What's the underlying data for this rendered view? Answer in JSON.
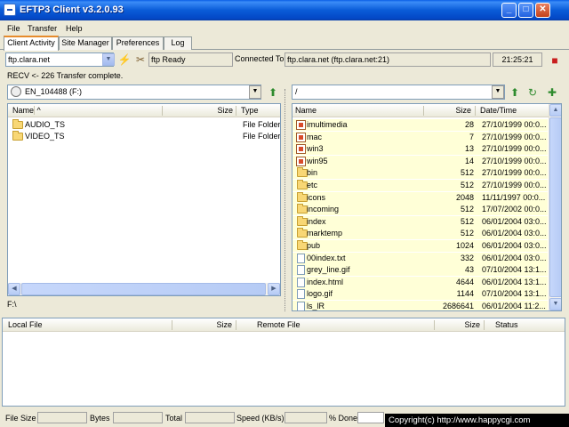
{
  "window": {
    "title": "EFTP3 Client v3.2.0.93"
  },
  "menu": [
    "File",
    "Transfer",
    "Help"
  ],
  "tabs": [
    "Client Activity",
    "Site Manager",
    "Preferences",
    "Log"
  ],
  "connection": {
    "host": "ftp.clara.net",
    "status": "ftp Ready",
    "connected_label": "Connected To",
    "connected_value": "ftp.clara.net (ftp.clara.net:21)",
    "time": "21:25:21"
  },
  "status_message": "RECV <-  226 Transfer complete.",
  "local": {
    "drive": "EN_104488 (F:)",
    "path": "F:\\",
    "columns": [
      "Name",
      "Size",
      "Type"
    ],
    "files": [
      {
        "name": "AUDIO_TS",
        "size": "",
        "type": "File Folder",
        "icon": "folder-icon"
      },
      {
        "name": "VIDEO_TS",
        "size": "",
        "type": "File Folder",
        "icon": "folder-icon"
      }
    ]
  },
  "remote": {
    "path": "/",
    "columns": [
      "Name",
      "Size",
      "Date/Time"
    ],
    "files": [
      {
        "name": "imultimedia",
        "size": "28",
        "date": "27/10/1999 00:0...",
        "icon": "link-icon"
      },
      {
        "name": "mac",
        "size": "7",
        "date": "27/10/1999 00:0...",
        "icon": "link-icon"
      },
      {
        "name": "win3",
        "size": "13",
        "date": "27/10/1999 00:0...",
        "icon": "link-icon"
      },
      {
        "name": "win95",
        "size": "14",
        "date": "27/10/1999 00:0...",
        "icon": "link-icon"
      },
      {
        "name": "bin",
        "size": "512",
        "date": "27/10/1999 00:0...",
        "icon": "folder-icon"
      },
      {
        "name": "etc",
        "size": "512",
        "date": "27/10/1999 00:0...",
        "icon": "folder-icon"
      },
      {
        "name": "icons",
        "size": "2048",
        "date": "11/11/1997 00:0...",
        "icon": "folder-icon"
      },
      {
        "name": "incoming",
        "size": "512",
        "date": "17/07/2002 00:0...",
        "icon": "folder-icon"
      },
      {
        "name": "index",
        "size": "512",
        "date": "06/01/2004 03:0...",
        "icon": "folder-icon"
      },
      {
        "name": "marktemp",
        "size": "512",
        "date": "06/01/2004 03:0...",
        "icon": "folder-icon"
      },
      {
        "name": "pub",
        "size": "1024",
        "date": "06/01/2004 03:0...",
        "icon": "folder-icon"
      },
      {
        "name": "00index.txt",
        "size": "332",
        "date": "06/01/2004 03:0...",
        "icon": "file-icon"
      },
      {
        "name": "grey_line.gif",
        "size": "43",
        "date": "07/10/2004 13:1...",
        "icon": "file-icon"
      },
      {
        "name": "index.html",
        "size": "4644",
        "date": "06/01/2004 13:1...",
        "icon": "file-icon"
      },
      {
        "name": "logo.gif",
        "size": "1144",
        "date": "07/10/2004 13:1...",
        "icon": "file-icon"
      },
      {
        "name": "ls_lR",
        "size": "2686641",
        "date": "06/01/2004 11:2...",
        "icon": "file-icon"
      }
    ]
  },
  "queue": {
    "columns": [
      "Local File",
      "Size",
      "Remote File",
      "Size",
      "Status"
    ]
  },
  "bottom": {
    "file_size_label": "File Size",
    "bytes_label": "Bytes",
    "total_label": "Total",
    "speed_label": "Speed (KB/s)",
    "done_label": "% Done",
    "copyright": "Copyright(c) http://www.happycgi.com"
  }
}
